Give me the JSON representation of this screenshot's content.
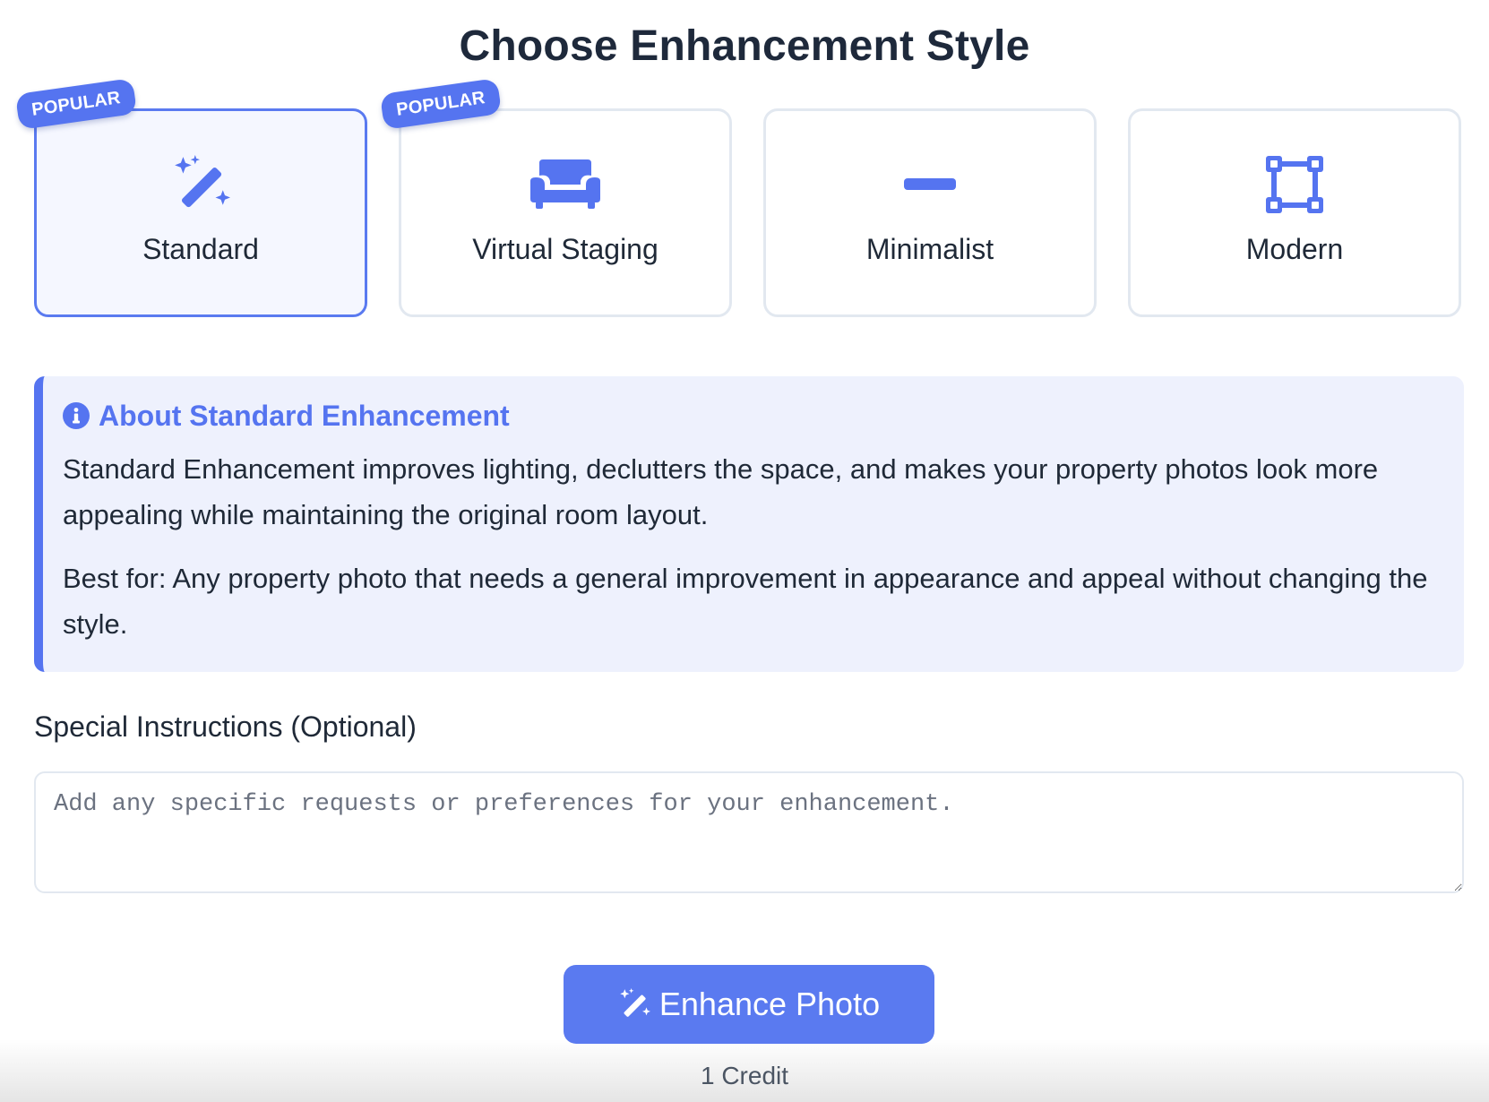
{
  "page": {
    "title": "Choose Enhancement Style"
  },
  "styles": [
    {
      "label": "Standard",
      "badge": "POPULAR",
      "icon": "magic-wand-icon",
      "selected": true
    },
    {
      "label": "Virtual Staging",
      "badge": "POPULAR",
      "icon": "couch-icon",
      "selected": false
    },
    {
      "label": "Minimalist",
      "badge": "",
      "icon": "minus-icon",
      "selected": false
    },
    {
      "label": "Modern",
      "badge": "",
      "icon": "vector-square-icon",
      "selected": false
    }
  ],
  "info": {
    "icon": "info-circle-icon",
    "title": "About Standard Enhancement",
    "description": "Standard Enhancement improves lighting, declutters the space, and makes your property photos look more appealing while maintaining the original room layout.",
    "best_for": "Best for: Any property photo that needs a general improvement in appearance and appeal without changing the style."
  },
  "instructions": {
    "label": "Special Instructions (Optional)",
    "placeholder": "Add any specific requests or preferences for your enhancement.",
    "value": ""
  },
  "action": {
    "icon": "magic-wand-icon",
    "label": "Enhance Photo",
    "cost": "1 Credit"
  },
  "colors": {
    "accent": "#5574f0",
    "selected_background": "#f5f7ff",
    "info_background": "#eef1fd",
    "card_border": "#e2e8f0",
    "heading": "#1e293b"
  }
}
